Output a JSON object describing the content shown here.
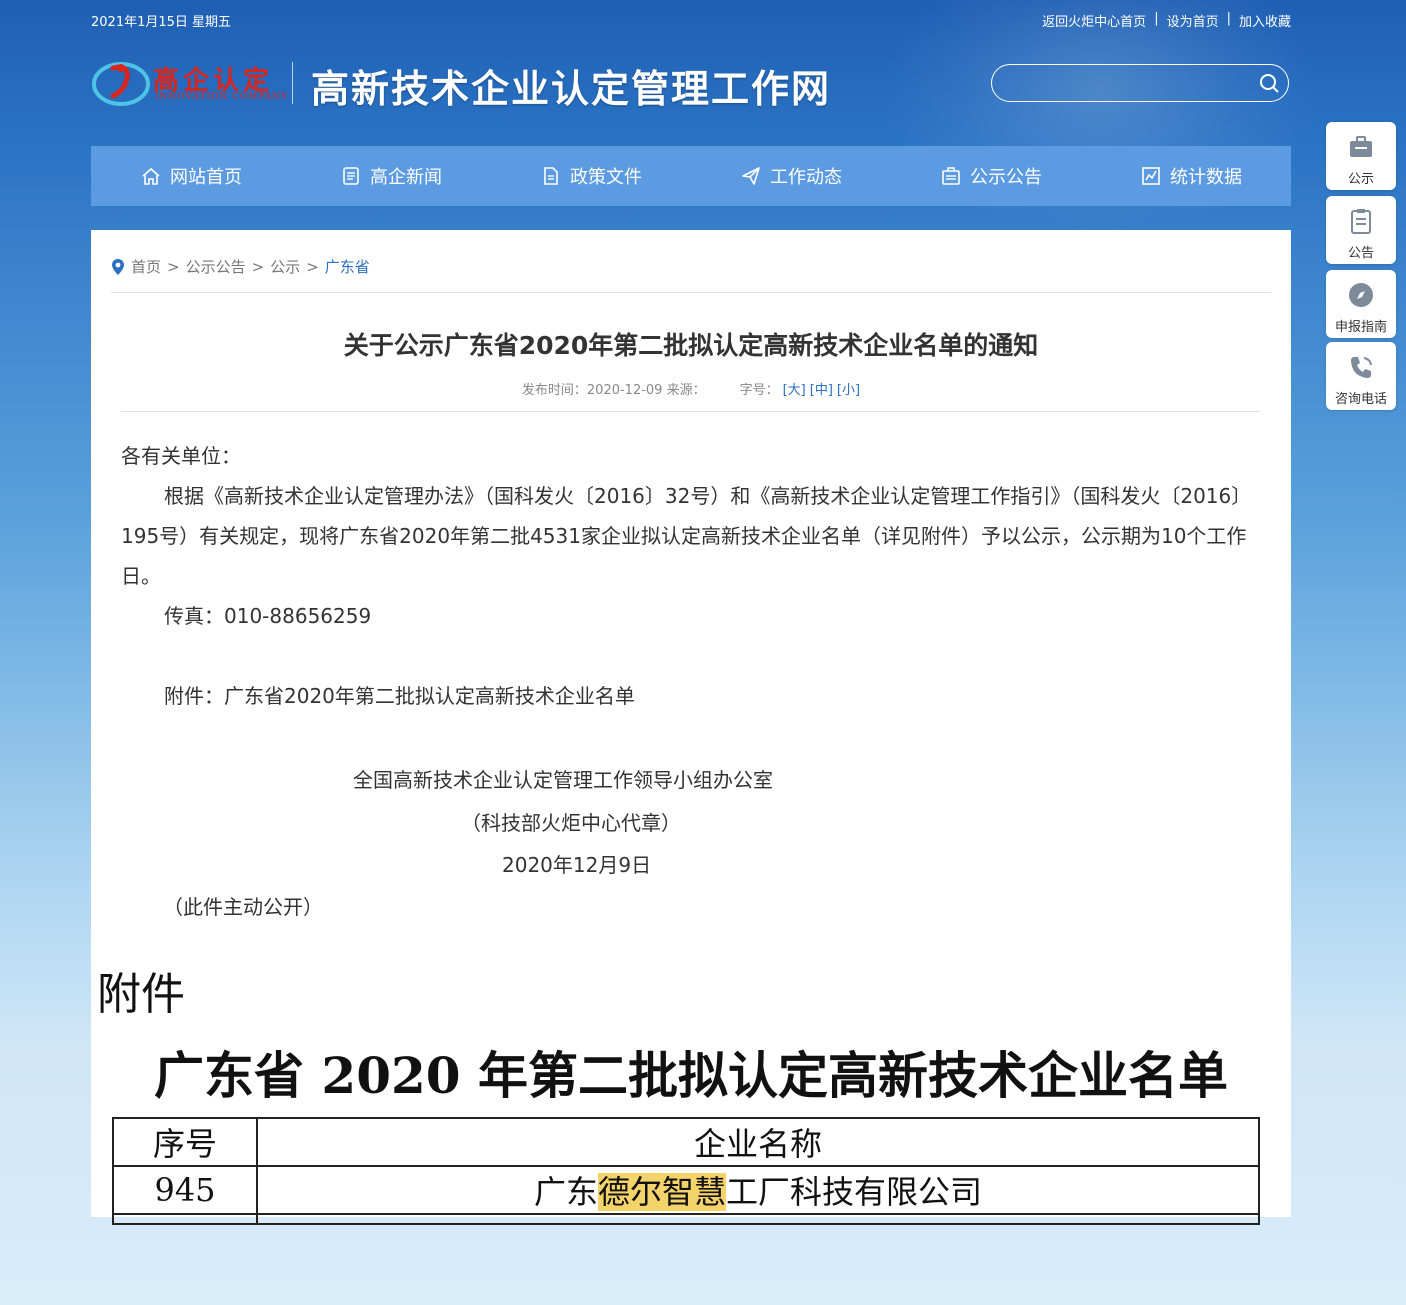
{
  "topbar": {
    "date": "2021年1月15日 星期五",
    "links": [
      "返回火炬中心首页",
      "设为首页",
      "加入收藏"
    ],
    "separator": "|"
  },
  "logo": {
    "cn": "高企认定",
    "en": "INNOVATION COMPANY"
  },
  "site_name": "高新技术企业认定管理工作网",
  "search": {
    "value": "",
    "icon": "search-icon"
  },
  "nav": [
    {
      "label": "网站首页",
      "icon": "home-icon"
    },
    {
      "label": "高企新闻",
      "icon": "news-icon"
    },
    {
      "label": "政策文件",
      "icon": "document-icon"
    },
    {
      "label": "工作动态",
      "icon": "paper-plane-icon"
    },
    {
      "label": "公示公告",
      "icon": "notice-icon"
    },
    {
      "label": "统计数据",
      "icon": "chart-icon"
    }
  ],
  "breadcrumb": {
    "items": [
      "首页",
      "公示公告",
      "公示"
    ],
    "current": "广东省",
    "sep": ">"
  },
  "article": {
    "title": "关于公示广东省2020年第二批拟认定高新技术企业名单的通知",
    "meta_time": "发布时间：2020-12-09 来源：",
    "font_size_label": "字号：",
    "font_sizes": [
      "[大]",
      "[中]",
      "[小]"
    ],
    "greeting": "各有关单位：",
    "para1": "根据《高新技术企业认定管理办法》（国科发火〔2016〕32号）和《高新技术企业认定管理工作指引》（国科发火〔2016〕195号）有关规定，现将广东省2020年第二批4531家企业拟认定高新技术企业名单（详见附件）予以公示，公示期为10个工作日。",
    "fax": "传真：010-88656259",
    "attachment": "附件：广东省2020年第二批拟认定高新技术企业名单",
    "signer": "全国高新技术企业认定管理工作领导小组办公室",
    "seal": "（科技部火炬中心代章）",
    "date": "2020年12月9日",
    "public_note": "（此件主动公开）"
  },
  "attachment_image": {
    "heading": "附件",
    "title": "广东省 2020 年第二批拟认定高新技术企业名单",
    "col_no": "序号",
    "col_name": "企业名称",
    "row_no": "945",
    "row_name_pre": "广东",
    "row_name_hl": "德尔智慧",
    "row_name_post": "工厂科技有限公司",
    "highlight_color": "#f5d36b"
  },
  "sidebar": [
    {
      "label": "公示",
      "icon": "briefcase-icon"
    },
    {
      "label": "公告",
      "icon": "clipboard-icon"
    },
    {
      "label": "申报指南",
      "icon": "compass-icon"
    },
    {
      "label": "咨询电话",
      "icon": "phone-icon"
    }
  ],
  "colors": {
    "nav": "#5c9be1",
    "accent": "#2a6fc2",
    "logo_red": "#d8251e"
  }
}
